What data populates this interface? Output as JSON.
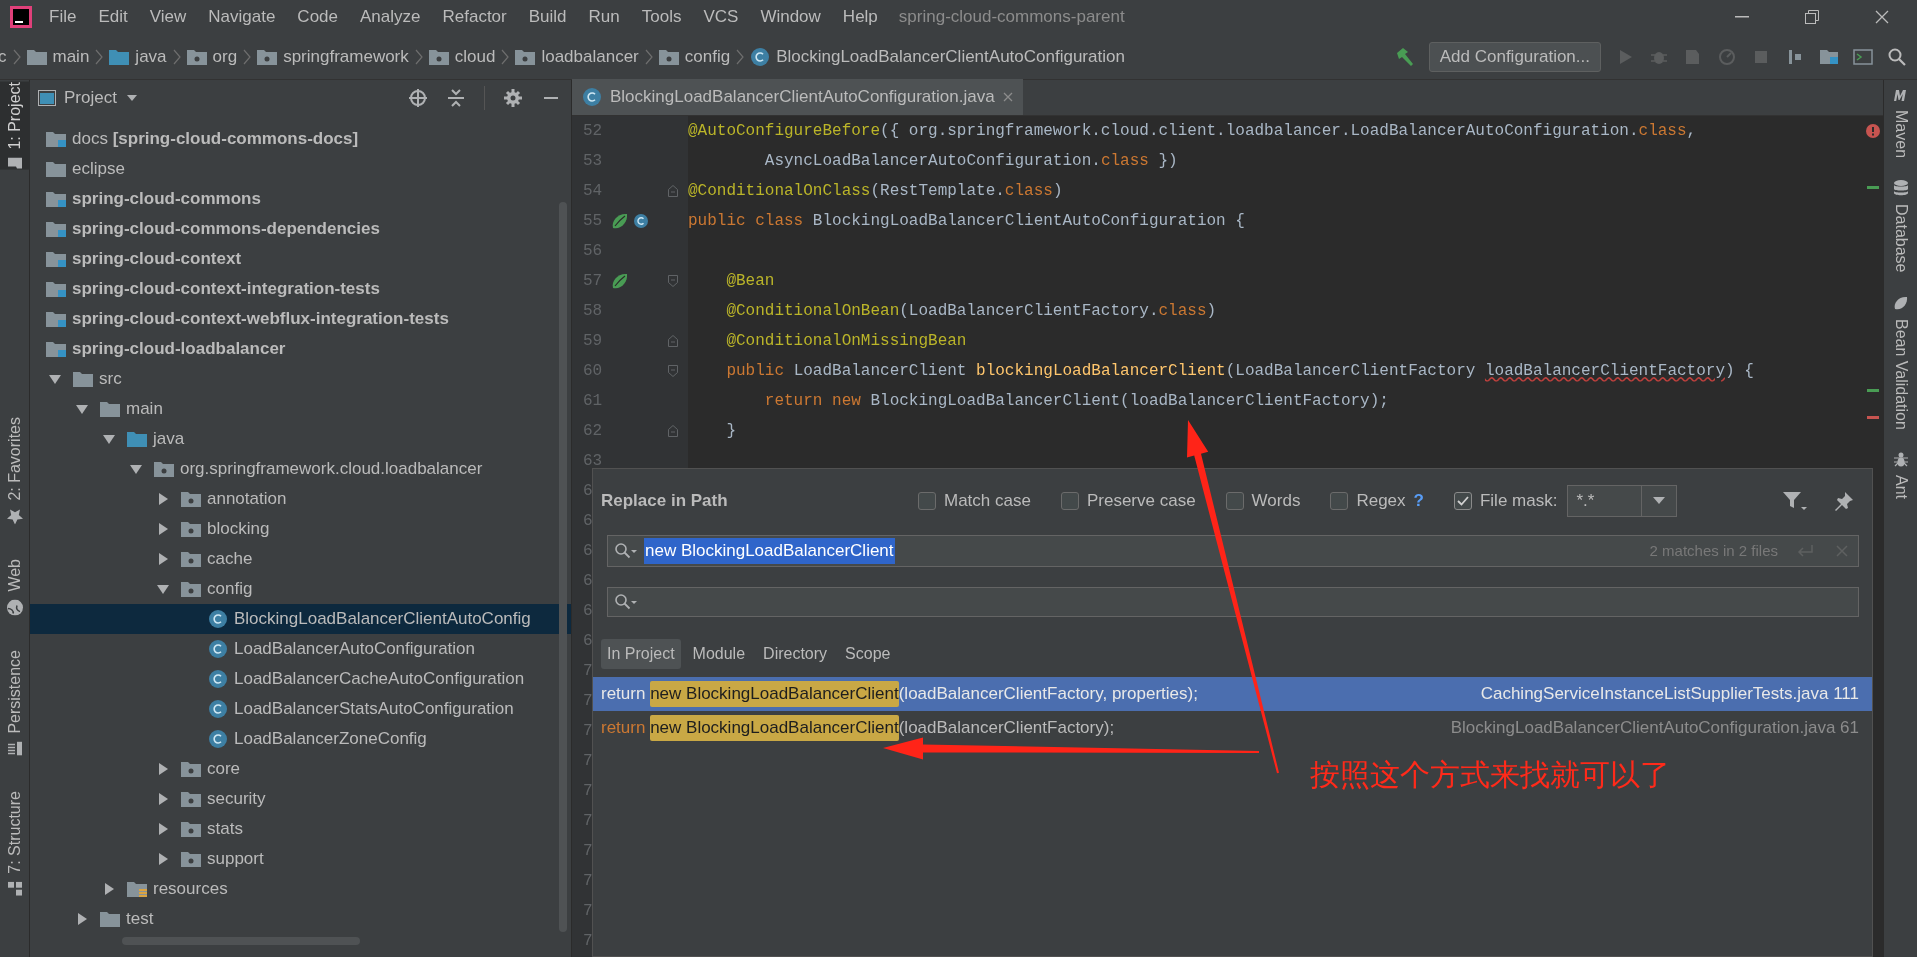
{
  "menu_bar": {
    "items": [
      "File",
      "Edit",
      "View",
      "Navigate",
      "Code",
      "Analyze",
      "Refactor",
      "Build",
      "Run",
      "Tools",
      "VCS",
      "Window",
      "Help"
    ],
    "project_title": "spring-cloud-commons-parent"
  },
  "nav_bar": {
    "breadcrumbs": [
      {
        "label": "c"
      },
      {
        "label": "main",
        "kind": "folder"
      },
      {
        "label": "java",
        "kind": "source"
      },
      {
        "label": "org",
        "kind": "package"
      },
      {
        "label": "springframework",
        "kind": "package"
      },
      {
        "label": "cloud",
        "kind": "package"
      },
      {
        "label": "loadbalancer",
        "kind": "package"
      },
      {
        "label": "config",
        "kind": "package"
      },
      {
        "label": "BlockingLoadBalancerClientAutoConfiguration",
        "kind": "class"
      }
    ],
    "run_config": "Add Configuration..."
  },
  "left_tool_strip": [
    {
      "label": "1: Project",
      "kind": "folder",
      "selected": true
    },
    {
      "label": "2: Favorites",
      "kind": "star",
      "selected": false
    },
    {
      "label": "Web",
      "kind": "globe",
      "selected": false
    },
    {
      "label": "Persistence",
      "kind": "persistence",
      "selected": false
    },
    {
      "label": "7: Structure",
      "kind": "structure",
      "selected": false
    }
  ],
  "right_tool_strip": [
    {
      "label": "Maven",
      "kind": "maven"
    },
    {
      "label": "Database",
      "kind": "database"
    },
    {
      "label": "Bean Validation",
      "kind": "bean"
    },
    {
      "label": "Ant",
      "kind": "ant"
    }
  ],
  "project_panel": {
    "title": "Project",
    "tree": [
      {
        "label": "docs **[spring-cloud-commons-docs]**",
        "kind": "module",
        "bold": false,
        "selected": false
      },
      {
        "label": "eclipse",
        "kind": "folder",
        "bold": false,
        "selected": false
      },
      {
        "label": "spring-cloud-commons",
        "kind": "module",
        "bold": true,
        "selected": false
      },
      {
        "label": "spring-cloud-commons-dependencies",
        "kind": "module",
        "bold": true,
        "selected": false
      },
      {
        "label": "spring-cloud-context",
        "kind": "module",
        "bold": true,
        "selected": false
      },
      {
        "label": "spring-cloud-context-integration-tests",
        "kind": "module",
        "bold": true,
        "selected": false
      },
      {
        "label": "spring-cloud-context-webflux-integration-tests",
        "kind": "module",
        "bold": true,
        "selected": false
      },
      {
        "label": "spring-cloud-loadbalancer",
        "kind": "module",
        "bold": true,
        "selected": false,
        "children": [
          {
            "label": "src",
            "kind": "folder",
            "expanded": true,
            "selected": false,
            "children": [
              {
                "label": "main",
                "kind": "folder",
                "expanded": true,
                "selected": false,
                "children": [
                  {
                    "label": "java",
                    "kind": "source",
                    "expanded": true,
                    "selected": false,
                    "children": [
                      {
                        "label": "org.springframework.cloud.loadbalancer",
                        "kind": "package",
                        "expanded": true,
                        "selected": false,
                        "children": [
                          {
                            "label": "annotation",
                            "kind": "package",
                            "expanded": false,
                            "selected": false
                          },
                          {
                            "label": "blocking",
                            "kind": "package",
                            "expanded": false,
                            "selected": false
                          },
                          {
                            "label": "cache",
                            "kind": "package",
                            "expanded": false,
                            "selected": false
                          },
                          {
                            "label": "config",
                            "kind": "package",
                            "expanded": true,
                            "selected": false,
                            "children": [
                              {
                                "label": "BlockingLoadBalancerClientAutoConfig",
                                "kind": "class",
                                "selected": true
                              },
                              {
                                "label": "LoadBalancerAutoConfiguration",
                                "kind": "class",
                                "selected": false
                              },
                              {
                                "label": "LoadBalancerCacheAutoConfiguration",
                                "kind": "class",
                                "selected": false
                              },
                              {
                                "label": "LoadBalancerStatsAutoConfiguration",
                                "kind": "class",
                                "selected": false
                              },
                              {
                                "label": "LoadBalancerZoneConfig",
                                "kind": "class",
                                "selected": false
                              }
                            ]
                          },
                          {
                            "label": "core",
                            "kind": "package",
                            "expanded": false,
                            "selected": false
                          },
                          {
                            "label": "security",
                            "kind": "package",
                            "expanded": false,
                            "selected": false
                          },
                          {
                            "label": "stats",
                            "kind": "package",
                            "expanded": false,
                            "selected": false
                          },
                          {
                            "label": "support",
                            "kind": "package",
                            "expanded": false,
                            "selected": false
                          }
                        ]
                      }
                    ]
                  },
                  {
                    "label": "resources",
                    "kind": "resources",
                    "expanded": false,
                    "selected": false
                  }
                ]
              },
              {
                "label": "test",
                "kind": "folder",
                "expanded": false,
                "selected": false
              }
            ]
          }
        ]
      }
    ]
  },
  "editor": {
    "tabs": [
      {
        "label": "BlockingLoadBalancerClientAutoConfiguration.java",
        "selected": true
      }
    ],
    "lines": [
      {
        "number": "52",
        "tokens": [
          {
            "kind": "ann",
            "text": "@AutoConfigureBefore"
          },
          {
            "kind": "plain",
            "text": "({ org.springframework.cloud.client.loadbalancer.LoadBalancerAutoConfiguration."
          },
          {
            "kind": "kw",
            "text": "class"
          },
          {
            "kind": "plain",
            "text": ","
          }
        ]
      },
      {
        "number": "53",
        "tokens": [
          {
            "kind": "plain",
            "text": "        AsyncLoadBalancerAutoConfiguration."
          },
          {
            "kind": "kw",
            "text": "class"
          },
          {
            "kind": "plain",
            "text": " })"
          }
        ]
      },
      {
        "number": "54",
        "gutter": [
          {
            "kind": "fold_end"
          }
        ],
        "tokens": [
          {
            "kind": "ann",
            "text": "@ConditionalOnClass"
          },
          {
            "kind": "plain",
            "text": "(RestTemplate."
          },
          {
            "kind": "kw",
            "text": "class"
          },
          {
            "kind": "plain",
            "text": ")"
          }
        ]
      },
      {
        "number": "55",
        "gutter": [
          {
            "kind": "bean"
          },
          {
            "kind": "implemented"
          }
        ],
        "tokens": [
          {
            "kind": "kw",
            "text": "public class "
          },
          {
            "kind": "plain",
            "text": "BlockingLoadBalancerClientAutoConfiguration {"
          }
        ]
      },
      {
        "number": "56"
      },
      {
        "number": "57",
        "gutter": [
          {
            "kind": "bean"
          },
          {
            "kind": "fold_start"
          }
        ],
        "tokens": [
          {
            "kind": "ann",
            "text": "    @Bean"
          }
        ]
      },
      {
        "number": "58",
        "tokens": [
          {
            "kind": "ann",
            "text": "    @ConditionalOnBean"
          },
          {
            "kind": "plain",
            "text": "(LoadBalancerClientFactory."
          },
          {
            "kind": "kw",
            "text": "class"
          },
          {
            "kind": "plain",
            "text": ")"
          }
        ]
      },
      {
        "number": "59",
        "gutter": [
          {
            "kind": "fold_end"
          }
        ],
        "tokens": [
          {
            "kind": "ann",
            "text": "    @ConditionalOnMissingBean"
          }
        ]
      },
      {
        "number": "60",
        "gutter": [
          {
            "kind": "fold_start"
          }
        ],
        "tokens": [
          {
            "kind": "kw",
            "text": "    public "
          },
          {
            "kind": "plain",
            "text": "LoadBalancerClient "
          },
          {
            "kind": "method",
            "text": "blockingLoadBalancerClient"
          },
          {
            "kind": "plain",
            "text": "(LoadBalancerClientFactory "
          },
          {
            "kind": "warn",
            "text": "loadBalancerClientFactory"
          },
          {
            "kind": "plain",
            "text": ") {"
          }
        ]
      },
      {
        "number": "61",
        "tokens": [
          {
            "kind": "kw",
            "text": "        return new "
          },
          {
            "kind": "plain",
            "text": "BlockingLoadBalancerClient(loadBalancerClientFactory);"
          }
        ]
      },
      {
        "number": "62",
        "gutter": [
          {
            "kind": "fold_end"
          }
        ],
        "tokens": [
          {
            "kind": "plain",
            "text": "    }"
          }
        ]
      },
      {
        "number": "63"
      }
    ],
    "covered_gutter": [
      "6",
      "6",
      "6",
      "6",
      "6",
      "6",
      "7",
      "7",
      "7",
      "7",
      "7",
      "7",
      "7",
      "7",
      "7",
      "7"
    ]
  },
  "replace_dialog": {
    "title": "Replace in Path",
    "options": [
      {
        "label": "Match case",
        "checked": false
      },
      {
        "label": "Preserve case",
        "checked": false
      },
      {
        "label": "Words",
        "checked": false
      },
      {
        "label": "Regex",
        "checked": false,
        "help": "?"
      },
      {
        "label": "File mask:",
        "checked": true
      }
    ],
    "file_mask": "*.*",
    "search": {
      "value": "new BlockingLoadBalancerClient",
      "match_count": "2 matches in 2 files"
    },
    "scopes": [
      {
        "label": "In Project",
        "selected": true
      },
      {
        "label": "Module",
        "selected": false
      },
      {
        "label": "Directory",
        "selected": false
      },
      {
        "label": "Scope",
        "selected": false
      }
    ],
    "results": [
      {
        "selected": true,
        "prefix": "return ",
        "match": "new BlockingLoadBalancerClient",
        "suffix": "(loadBalancerClientFactory, properties);",
        "location": "CachingServiceInstanceListSupplierTests.java 111"
      },
      {
        "selected": false,
        "prefix": "return ",
        "match": "new BlockingLoadBalancerClient",
        "suffix": "(loadBalancerClientFactory);",
        "location": "BlockingLoadBalancerClientAutoConfiguration.java 61"
      }
    ]
  },
  "annotation": {
    "note": "按照这个方式来找就可以了"
  }
}
